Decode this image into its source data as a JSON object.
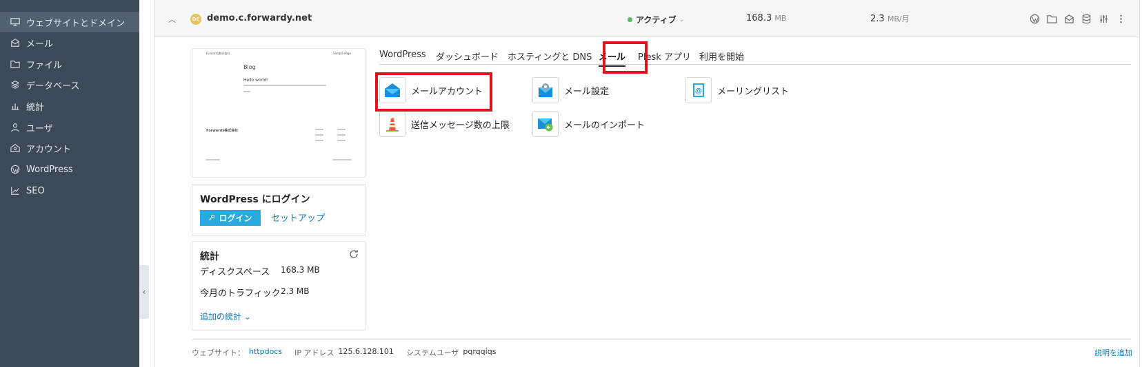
{
  "sidebar": {
    "items": [
      {
        "label": "ウェブサイトとドメイン",
        "icon": "monitor-icon"
      },
      {
        "label": "メール",
        "icon": "envelope-icon"
      },
      {
        "label": "ファイル",
        "icon": "folder-icon"
      },
      {
        "label": "データベース",
        "icon": "layers-icon"
      },
      {
        "label": "統計",
        "icon": "bar-chart-icon"
      },
      {
        "label": "ユーザ",
        "icon": "user-icon"
      },
      {
        "label": "アカウント",
        "icon": "account-icon"
      },
      {
        "label": "WordPress",
        "icon": "wordpress-icon"
      },
      {
        "label": "SEO",
        "icon": "seo-icon"
      }
    ],
    "collapse_glyph": "‹"
  },
  "site": {
    "favicon_text": "DE",
    "domain": "demo.c.forwardy.net",
    "status": "アクティブ",
    "disk_value": "168.3",
    "disk_unit": "MB",
    "traffic_value": "2.3",
    "traffic_unit": "MB/月"
  },
  "preview": {
    "brand_top": "Forwardy株式会社",
    "top_right": "Sample Page",
    "blog": "Blog",
    "hello": "Hello world!",
    "company": "Forwardy株式会社"
  },
  "wp_login": {
    "title": "WordPress にログイン",
    "login_button": "ログイン",
    "setup_link": "セットアップ"
  },
  "stats": {
    "title": "統計",
    "disk_label": "ディスクスペース",
    "disk_value": "168.3 MB",
    "traffic_label": "今月のトラフィック",
    "traffic_value": "2.3 MB",
    "more_link": "追加の統計 ⌄"
  },
  "tabs": [
    "WordPress",
    "ダッシュボード",
    "ホスティングと DNS",
    "メール",
    "Plesk アプリ",
    "利用を開始"
  ],
  "active_tab": "メール",
  "tools": [
    {
      "label": "メールアカウント",
      "icon": "mail-account-icon"
    },
    {
      "label": "メール設定",
      "icon": "mail-settings-icon"
    },
    {
      "label": "メーリングリスト",
      "icon": "mailing-list-icon"
    },
    {
      "label": "送信メッセージ数の上限",
      "icon": "outgoing-limit-icon"
    },
    {
      "label": "メールのインポート",
      "icon": "mail-import-icon"
    }
  ],
  "footer": {
    "website_label": "ウェブサイト：",
    "website_value": "httpdocs",
    "ip_label": "IP アドレス",
    "ip_value": "125.6.128.101",
    "sysuser_label": "システムユーザ",
    "sysuser_value": "pqrqqiqs",
    "add_description": "説明を追加"
  },
  "colors": {
    "sidebar_bg": "#3c4a58",
    "accent_blue": "#28aade",
    "link": "#0f78b4",
    "highlight_red": "#e0141e",
    "status_green": "#5cb85c"
  }
}
